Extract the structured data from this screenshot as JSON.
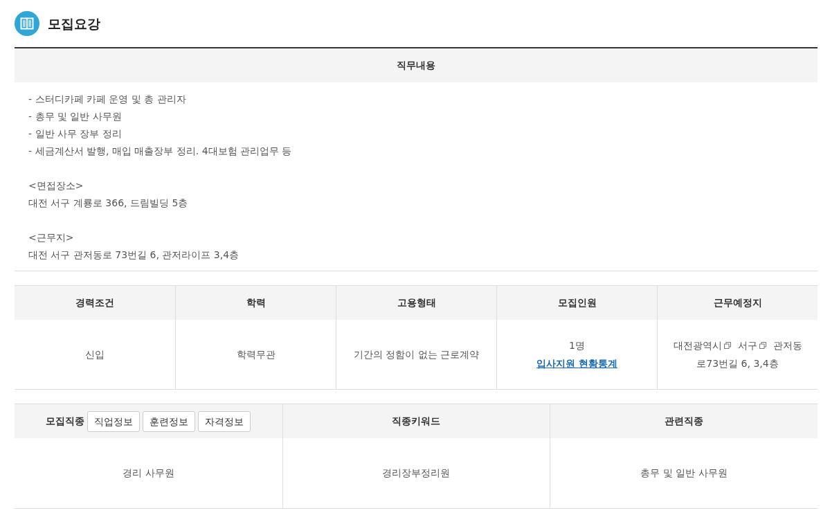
{
  "section": {
    "title": "모집요강"
  },
  "job_description": {
    "heading": "직무내용",
    "paragraphs": [
      [
        "- 스터디카페 카페 운영 및 총 관리자",
        "- 총무 및 일반 사무원",
        "- 일반 사무 장부 정리",
        "- 세금계산서 발행, 매입 매출장부 정리. 4대보험 관리업무 등"
      ],
      [
        "<면접장소>",
        "대전 서구 계룡로 366, 드림빌딩 5층"
      ],
      [
        "<근무지>",
        "대전 서구 관저동로 73번길 6, 관저라이프 3,4층"
      ]
    ]
  },
  "conditions": {
    "columns": [
      "경력조건",
      "학력",
      "고용형태",
      "모집인원",
      "근무예정지"
    ],
    "cells": [
      [
        {
          "kind": "text",
          "text": "신입"
        }
      ],
      [
        {
          "kind": "text",
          "text": "학력무관"
        }
      ],
      [
        {
          "kind": "text",
          "text": "기간의 정함이 없는 근로계약"
        }
      ],
      [
        {
          "kind": "text",
          "text": "1명"
        },
        {
          "kind": "link",
          "text": "입사지원 현황통계"
        }
      ],
      [
        {
          "kind": "place",
          "lines": [
            [
              {
                "text": "대전광역시",
                "popup": true
              },
              {
                "text": "서구",
                "popup": true
              },
              {
                "text": "관저동",
                "popup": false
              }
            ],
            [
              {
                "text": "로73번길 6, 3,4층",
                "popup": false
              }
            ]
          ]
        }
      ]
    ]
  },
  "occupation": {
    "columns": [
      {
        "label": "모집직종",
        "buttons": [
          "직업정보",
          "훈련정보",
          "자격정보"
        ]
      },
      {
        "label": "직종키워드"
      },
      {
        "label": "관련직종"
      }
    ],
    "cells": [
      "경리 사무원",
      "경리장부정리원",
      "총무 및 일반 사무원"
    ]
  }
}
